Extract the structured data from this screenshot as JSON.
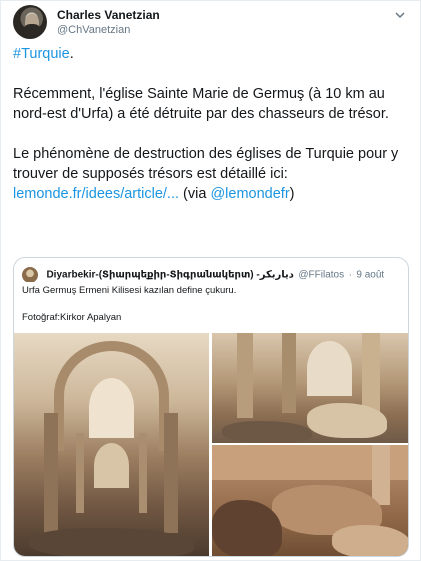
{
  "author": {
    "display_name": "Charles Vanetzian",
    "handle": "@ChVanetzian"
  },
  "tweet": {
    "hashtag": "#Turquie",
    "hashtag_suffix": ".",
    "paragraph1": "Récemment, l'église Sainte Marie de Germuş (à 10 km au nord-est d'Urfa) a été détruite par des chasseurs de trésor.",
    "paragraph2": "Le phénomène de destruction des églises de Turquie pour y trouver de supposés trésors est détaillé ici:",
    "link": "lemonde.fr/idees/article/...",
    "via_prefix": " (via ",
    "via_mention": "@lemondefr",
    "via_suffix": ")"
  },
  "quoted_tweet": {
    "name": "Diyarbekir-(Տիարպեքիր-Տիգրանակերտ) -دیاربکر",
    "handle": "@FFilatos",
    "separator": "·",
    "date": "9 août",
    "text_line1": "Urfa Germuş Ermeni Kilisesi kazılan define çukuru.",
    "text_line2": "Fotoğraf:Kirkor Apalyan"
  },
  "icons": {
    "caret": "chevron-down-icon"
  },
  "colors": {
    "link": "#1b95e0",
    "secondary_text": "#657786",
    "border": "#ccd6dd"
  }
}
